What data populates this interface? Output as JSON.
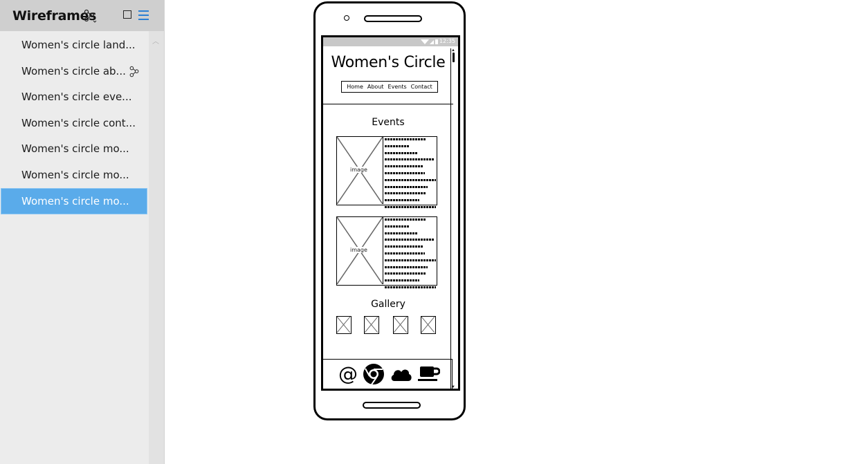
{
  "sidebar": {
    "title": "Wireframes",
    "items": [
      {
        "label": "Women's circle land..."
      },
      {
        "label": "Women's circle ab..."
      },
      {
        "label": "Women's circle eve..."
      },
      {
        "label": "Women's circle cont..."
      },
      {
        "label": "Women's circle mo..."
      },
      {
        "label": "Women's circle mo..."
      },
      {
        "label": "Women's circle mo..."
      }
    ],
    "selected_index": 6,
    "icons": {
      "branch": "branch-icon",
      "square": "square-icon",
      "list": "list-icon"
    },
    "colors": {
      "selected": "#5aabea",
      "header": "#cfcfcf",
      "list_icon": "#2b7fd4"
    }
  },
  "phone": {
    "status_time": "12:35",
    "app_title": "Women's Circle",
    "nav": [
      "Home",
      "About",
      "Events",
      "Contact"
    ],
    "events_heading": "Events",
    "image_label": "image",
    "gallery_heading": "Gallery",
    "bottom_icons": [
      "at-icon",
      "chrome-icon",
      "cloud-icon",
      "coffee-icon"
    ],
    "bottom_glyphs": {
      "at": "@"
    }
  }
}
